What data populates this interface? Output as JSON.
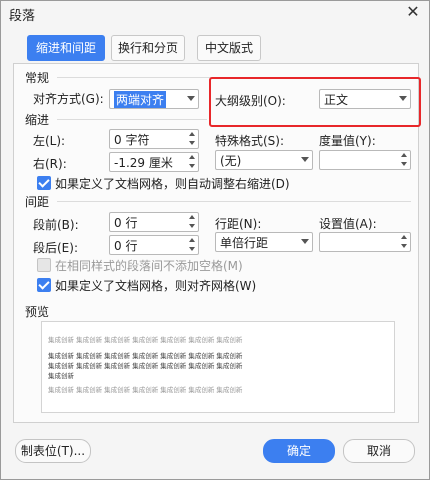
{
  "dialog": {
    "title": "段落",
    "close_glyph": "✕"
  },
  "tabs": [
    {
      "label": "缩进和间距",
      "active": true
    },
    {
      "label": "换行和分页",
      "active": false
    },
    {
      "label": "中文版式",
      "active": false
    }
  ],
  "general": {
    "section_title": "常规",
    "alignment_label": "对齐方式(G):",
    "alignment_value": "两端对齐",
    "outline_label": "大纲级别(O):",
    "outline_value": "正文"
  },
  "indent": {
    "section_title": "缩进",
    "left_label": "左(L):",
    "left_value": "0 字符",
    "right_label": "右(R):",
    "right_value": "-1.29 厘米",
    "special_label": "特殊格式(S):",
    "special_value": "(无)",
    "measure_label": "度量值(Y):",
    "measure_value": "",
    "grid_checkbox_label": "如果定义了文档网格，则自动调整右缩进(D)"
  },
  "spacing": {
    "section_title": "间距",
    "before_label": "段前(B):",
    "before_value": "0 行",
    "after_label": "段后(E):",
    "after_value": "0 行",
    "line_spacing_label": "行距(N):",
    "line_spacing_value": "单倍行距",
    "set_value_label": "设置值(A):",
    "set_value": "",
    "no_space_checkbox_label": "在相同样式的段落间不添加空格(M)",
    "align_grid_checkbox_label": "如果定义了文档网格，则对齐网格(W)"
  },
  "preview": {
    "section_title": "预览",
    "sample_text": "集成创新 集成创新 集成创新 集成创新 集成创新 集成创新 集成创新",
    "sample_tail": "集成创新"
  },
  "buttons": {
    "tabs_button": "制表位(T)...",
    "ok": "确定",
    "cancel": "取消"
  },
  "colors": {
    "accent": "#3c7ff0",
    "highlight": "#e8272a"
  }
}
